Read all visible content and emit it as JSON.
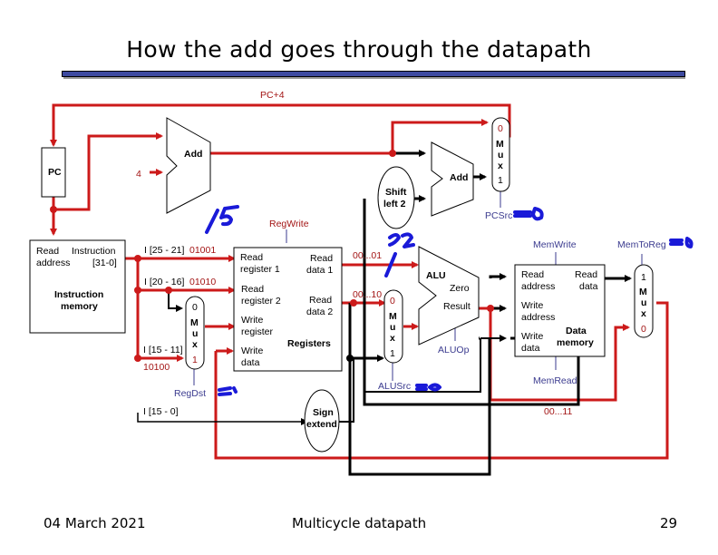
{
  "slide": {
    "title": "How the add goes through the datapath",
    "footer_date": "04 March 2021",
    "footer_center": "Multicycle datapath",
    "page_number": "29"
  },
  "colors": {
    "active_wire": "#cc1a1a",
    "inactive_wire": "#000000",
    "control_label": "#3b3b8f",
    "value_label": "#a31515",
    "handwriting": "#1a1ad8",
    "title_bar": "#3d4aa0"
  },
  "datapath": {
    "pc_plus_4_label": "PC+4",
    "pc_label": "PC",
    "add_pc_label": "Add",
    "constant_four": "4",
    "add_branch_label": "Add",
    "shift_left_line1": "Shift",
    "shift_left_line2": "left 2",
    "pc_mux": {
      "input0": "0",
      "m": "M",
      "u": "u",
      "x": "x",
      "input1": "1",
      "control": "PCSrc"
    },
    "instruction_memory": {
      "read_label": "Read",
      "instruction_label": "Instruction",
      "address_label": "address",
      "bits_label": "[31-0]",
      "name_line1": "Instruction",
      "name_line2": "memory"
    },
    "fields": {
      "rs_bits": "I [25 - 21]",
      "rs_value": "01001",
      "rt_bits": "I [20 - 16]",
      "rt_value": "01010",
      "rd_bits": "I [15 - 11]",
      "rd_value": "10100",
      "imm_bits": "I [15 - 0]"
    },
    "regdst_mux": {
      "input0": "0",
      "m": "M",
      "u": "u",
      "x": "x",
      "input1": "1",
      "control": "RegDst"
    },
    "registers": {
      "control": "RegWrite",
      "read_reg1_l1": "Read",
      "read_reg1_l2": "register 1",
      "read_reg2_l1": "Read",
      "read_reg2_l2": "register 2",
      "write_reg_l1": "Write",
      "write_reg_l2": "register",
      "write_data_l1": "Write",
      "write_data_l2": "data",
      "read_data1_l1": "Read",
      "read_data1_l2": "data 1",
      "read_data2_l1": "Read",
      "read_data2_l2": "data 2",
      "name": "Registers"
    },
    "read_data1_value": "00...01",
    "read_data2_value": "00...10",
    "sign_extend_l1": "Sign",
    "sign_extend_l2": "extend",
    "alusrc_mux": {
      "input0": "0",
      "m": "M",
      "u": "u",
      "x": "x",
      "input1": "1",
      "control": "ALUSrc"
    },
    "alu": {
      "name": "ALU",
      "zero": "Zero",
      "result": "Result",
      "control": "ALUOp"
    },
    "data_memory": {
      "control_write": "MemWrite",
      "control_read": "MemRead",
      "read_address_l1": "Read",
      "read_address_l2": "address",
      "write_address_l1": "Write",
      "write_address_l2": "address",
      "write_data_l1": "Write",
      "write_data_l2": "data",
      "read_data_l1": "Read",
      "read_data_l2": "data",
      "name_l1": "Data",
      "name_l2": "memory"
    },
    "memtoreg_mux": {
      "input1": "1",
      "m": "M",
      "u": "u",
      "x": "x",
      "input0": "0",
      "control": "MemToReg"
    },
    "alu_result_value": "00...11"
  },
  "handwritten_annotations": {
    "bus_width_pc": "15",
    "bus_width_alu": "32",
    "pcsrc_value": "=0",
    "regdst_value": "=1",
    "alusrc_value": "=0",
    "memtoreg_value": "=0"
  }
}
